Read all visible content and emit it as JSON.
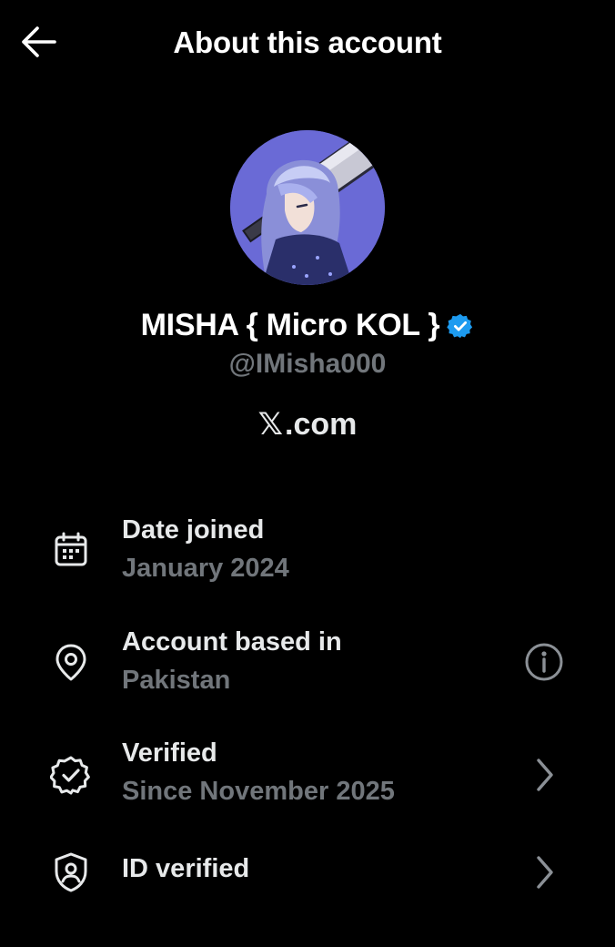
{
  "header": {
    "title": "About this account",
    "back_icon": "arrow-left-icon"
  },
  "profile": {
    "display_name": "MISHA { Micro KOL }",
    "verified_badge_icon": "verified-badge-icon",
    "handle": "@IMisha000",
    "site_logo_text": "𝕏",
    "site_domain": ".com"
  },
  "details": [
    {
      "icon": "calendar-icon",
      "title": "Date joined",
      "subtitle": "January 2024",
      "trailing": null
    },
    {
      "icon": "location-pin-icon",
      "title": "Account based in",
      "subtitle": "Pakistan",
      "trailing": "info-icon"
    },
    {
      "icon": "verified-seal-icon",
      "title": "Verified",
      "subtitle": "Since November 2025",
      "trailing": "chevron-right-icon"
    },
    {
      "icon": "id-shield-icon",
      "title": "ID verified",
      "subtitle": "",
      "trailing": "chevron-right-icon"
    }
  ],
  "colors": {
    "background": "#000000",
    "primary_text": "#e7e9ea",
    "secondary_text": "#71767b",
    "verified_blue": "#1d9bf0",
    "avatar_bg": "#6a6ad6"
  }
}
